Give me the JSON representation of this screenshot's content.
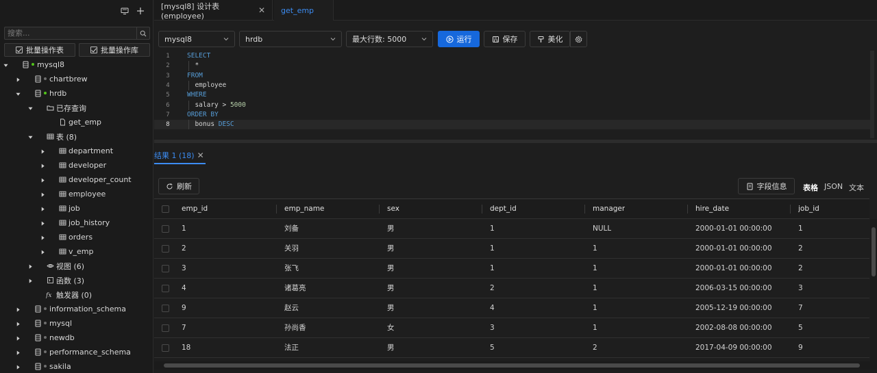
{
  "sidebar": {
    "search_placeholder": "搜索...",
    "batch_table_label": "批量操作表",
    "batch_db_label": "批量操作库",
    "tree": [
      {
        "label": "mysql8",
        "level": 0,
        "arrow": "down",
        "icon": "database",
        "dot": "green"
      },
      {
        "label": "chartbrew",
        "level": 1,
        "arrow": "right",
        "icon": "database",
        "dot": "gray"
      },
      {
        "label": "hrdb",
        "level": 1,
        "arrow": "down",
        "icon": "database",
        "dot": "green"
      },
      {
        "label": "已存查询",
        "level": 2,
        "arrow": "down",
        "icon": "folder"
      },
      {
        "label": "get_emp",
        "level": 3,
        "arrow": "none",
        "icon": "file"
      },
      {
        "label": "表 (8)",
        "level": 2,
        "arrow": "down",
        "icon": "table"
      },
      {
        "label": "department",
        "level": 3,
        "arrow": "right",
        "icon": "table"
      },
      {
        "label": "developer",
        "level": 3,
        "arrow": "right",
        "icon": "table"
      },
      {
        "label": "developer_count",
        "level": 3,
        "arrow": "right",
        "icon": "table"
      },
      {
        "label": "employee",
        "level": 3,
        "arrow": "right",
        "icon": "table"
      },
      {
        "label": "job",
        "level": 3,
        "arrow": "right",
        "icon": "table"
      },
      {
        "label": "job_history",
        "level": 3,
        "arrow": "right",
        "icon": "table"
      },
      {
        "label": "orders",
        "level": 3,
        "arrow": "right",
        "icon": "table"
      },
      {
        "label": "v_emp",
        "level": 3,
        "arrow": "right",
        "icon": "table"
      },
      {
        "label": "视图 (6)",
        "level": 2,
        "arrow": "right",
        "icon": "eye"
      },
      {
        "label": "函数 (3)",
        "level": 2,
        "arrow": "right",
        "icon": "function"
      },
      {
        "label": "触发器 (0)",
        "level": 2,
        "arrow": "none",
        "icon": "fx"
      },
      {
        "label": "information_schema",
        "level": 1,
        "arrow": "right",
        "icon": "database",
        "dot": "gray"
      },
      {
        "label": "mysql",
        "level": 1,
        "arrow": "right",
        "icon": "database",
        "dot": "gray"
      },
      {
        "label": "newdb",
        "level": 1,
        "arrow": "right",
        "icon": "database",
        "dot": "gray"
      },
      {
        "label": "performance_schema",
        "level": 1,
        "arrow": "right",
        "icon": "database",
        "dot": "gray"
      },
      {
        "label": "sakila",
        "level": 1,
        "arrow": "right",
        "icon": "database",
        "dot": "gray"
      }
    ]
  },
  "tabs": [
    {
      "label": "[mysql8] 设计表 (employee)",
      "active": false
    },
    {
      "label": "get_emp",
      "active": true
    }
  ],
  "toolbar": {
    "connection": "mysql8",
    "database": "hrdb",
    "max_rows": "最大行数: 5000",
    "run_label": "运行",
    "save_label": "保存",
    "format_label": "美化"
  },
  "editor": {
    "lines": [
      [
        {
          "t": "SELECT",
          "c": "kw"
        }
      ],
      [
        {
          "t": "  *",
          "c": "op"
        }
      ],
      [
        {
          "t": "FROM",
          "c": "kw"
        }
      ],
      [
        {
          "t": "  employee",
          "c": "id"
        }
      ],
      [
        {
          "t": "WHERE",
          "c": "kw"
        }
      ],
      [
        {
          "t": "  salary ",
          "c": "id"
        },
        {
          "t": ">",
          "c": "op"
        },
        {
          "t": " 5000",
          "c": "num"
        }
      ],
      [
        {
          "t": "ORDER BY",
          "c": "kw"
        }
      ],
      [
        {
          "t": "  bonus ",
          "c": "id"
        },
        {
          "t": "DESC",
          "c": "kw"
        }
      ]
    ],
    "active_line": 8
  },
  "results": {
    "tab_label": "结果 1 (18)",
    "refresh_label": "刷新",
    "field_info_label": "字段信息",
    "view_modes": [
      "表格",
      "JSON",
      "文本"
    ],
    "columns": [
      "emp_id",
      "emp_name",
      "sex",
      "dept_id",
      "manager",
      "hire_date",
      "job_id"
    ],
    "rows": [
      [
        "1",
        "刘备",
        "男",
        "1",
        "NULL",
        "2000-01-01 00:00:00",
        "1"
      ],
      [
        "2",
        "关羽",
        "男",
        "1",
        "1",
        "2000-01-01 00:00:00",
        "2"
      ],
      [
        "3",
        "张飞",
        "男",
        "1",
        "1",
        "2000-01-01 00:00:00",
        "2"
      ],
      [
        "4",
        "诸葛亮",
        "男",
        "2",
        "1",
        "2006-03-15 00:00:00",
        "3"
      ],
      [
        "9",
        "赵云",
        "男",
        "4",
        "1",
        "2005-12-19 00:00:00",
        "7"
      ],
      [
        "7",
        "孙尚香",
        "女",
        "3",
        "1",
        "2002-08-08 00:00:00",
        "5"
      ],
      [
        "18",
        "法正",
        "男",
        "5",
        "2",
        "2017-04-09 00:00:00",
        "9"
      ],
      [
        "",
        "",
        "",
        "",
        "",
        "",
        ""
      ]
    ]
  },
  "colors": {
    "accent": "#1668dc",
    "link": "#3c8cf2",
    "status_green": "#52c41a",
    "status_gray": "#6e6e6e"
  }
}
